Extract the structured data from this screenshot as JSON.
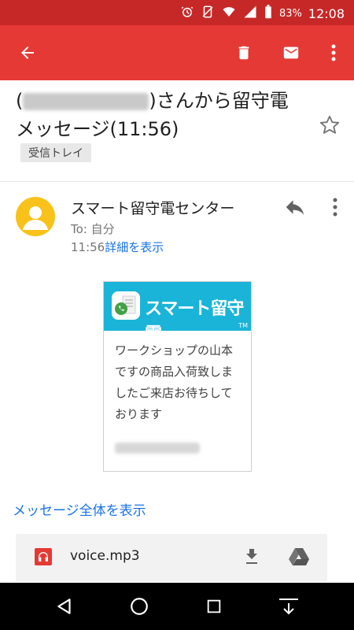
{
  "status_bar": {
    "battery": "83%",
    "time": "12:08",
    "icons": [
      "alarm-icon",
      "signal-blocked-icon",
      "wifi-icon",
      "cell-signal-icon",
      "battery-icon"
    ]
  },
  "app_bar": {
    "icons": [
      "back-arrow-icon",
      "trash-icon",
      "mail-icon",
      "more-vert-icon"
    ],
    "color": "#e53935"
  },
  "email": {
    "subject_prefix": "(",
    "subject_after_blur": ")さんから留守電",
    "subject_line2": "メッセージ(11:56)",
    "label": "受信トレイ",
    "sender": "スマート留守電センター",
    "to": "To: 自分",
    "time": "11:56",
    "details_link": "詳細を表示",
    "card": {
      "brand": "スマート留守電",
      "tm": "TM",
      "message": "ワークショップの山本ですの商品入荷致しましたご来店お待ちしております",
      "brand_color": "#1ab4d8"
    },
    "view_all": "メッセージ全体を表示",
    "attachment": {
      "name": "voice.mp3"
    }
  },
  "nav_bar": {
    "icons": [
      "back-triangle-icon",
      "home-circle-icon",
      "recents-square-icon",
      "notification-dropdown-icon"
    ]
  }
}
